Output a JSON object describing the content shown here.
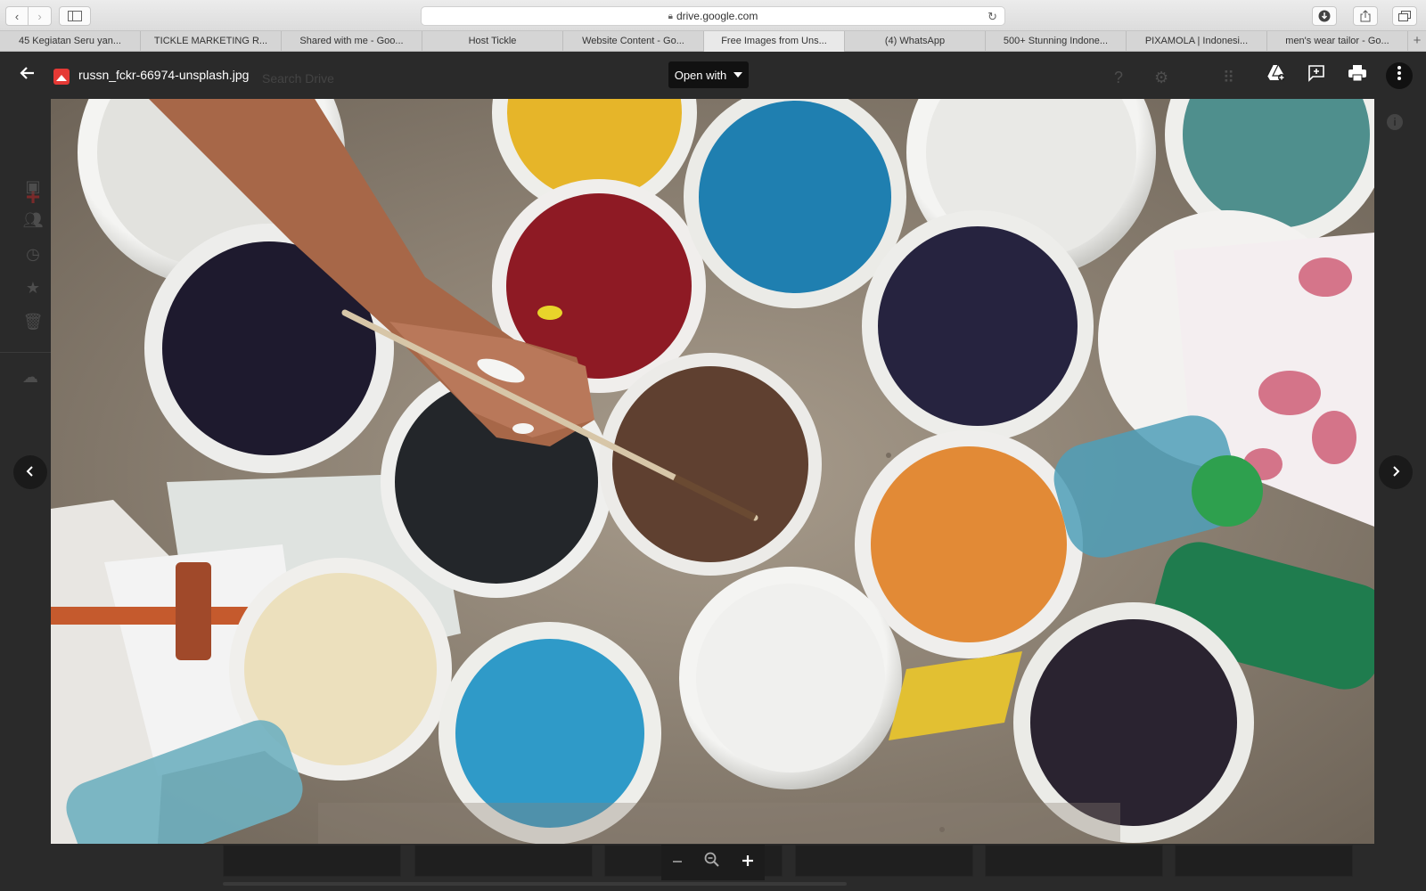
{
  "browser": {
    "address": "drive.google.com",
    "tabs": [
      "45 Kegiatan Seru yan...",
      "TICKLE MARKETING R...",
      "Shared with me - Goo...",
      "Host Tickle",
      "Website Content - Go...",
      "Free Images from Uns...",
      "(4) WhatsApp",
      "500+ Stunning Indone...",
      "PIXAMOLA | Indonesi...",
      "men's wear tailor - Go..."
    ],
    "active_tab_index": 5
  },
  "drive_background": {
    "search_placeholder": "Search Drive"
  },
  "viewer": {
    "file_name": "russn_fckr-66974-unsplash.jpg",
    "open_with_label": "Open with",
    "image_description_icon": "image-file-icon"
  },
  "icons": {
    "back": "arrow-left-icon",
    "add_to_drive": "add-to-drive-icon",
    "comment": "add-comment-icon",
    "print": "print-icon",
    "more": "more-vert-icon",
    "prev": "chevron-left-icon",
    "next": "chevron-right-icon",
    "zoom_out": "zoom-out-icon",
    "zoom_reset": "zoom-reset-icon",
    "zoom_in": "zoom-in-icon"
  },
  "colors": {
    "file_icon": "#e53935",
    "viewer_bg": "#2a2a2a"
  }
}
